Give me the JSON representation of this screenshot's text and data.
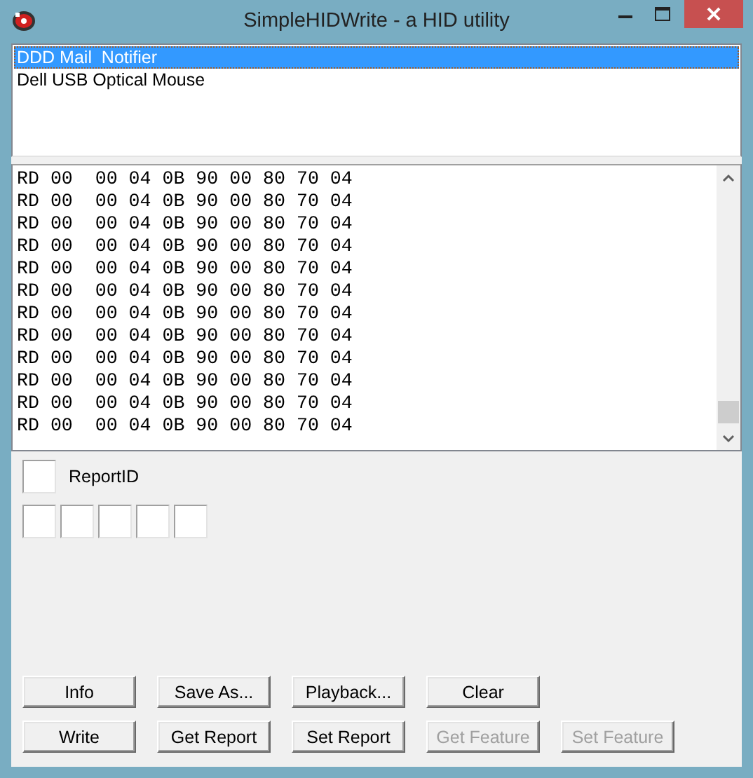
{
  "window": {
    "title": "SimpleHIDWrite - a HID utility"
  },
  "devices": [
    {
      "name": "DDD Mail  Notifier",
      "selected": true
    },
    {
      "name": "Dell USB Optical Mouse",
      "selected": false
    }
  ],
  "log": [
    "RD 00  00 04 0B 90 00 80 70 04",
    "RD 00  00 04 0B 90 00 80 70 04",
    "RD 00  00 04 0B 90 00 80 70 04",
    "RD 00  00 04 0B 90 00 80 70 04",
    "RD 00  00 04 0B 90 00 80 70 04",
    "RD 00  00 04 0B 90 00 80 70 04",
    "RD 00  00 04 0B 90 00 80 70 04",
    "RD 00  00 04 0B 90 00 80 70 04",
    "RD 00  00 04 0B 90 00 80 70 04",
    "RD 00  00 04 0B 90 00 80 70 04",
    "RD 00  00 04 0B 90 00 80 70 04",
    "RD 00  00 04 0B 90 00 80 70 04"
  ],
  "report_id": {
    "label": "ReportID"
  },
  "byte_fields": [
    {
      "kind": "hex"
    },
    {
      "kind": "hex"
    },
    {
      "kind": "hex"
    },
    {
      "kind": "hex"
    },
    {
      "kind": "hex"
    }
  ],
  "button_rows": [
    [
      {
        "label": "Info",
        "disabled": false
      },
      {
        "label": "Save As...",
        "disabled": false
      },
      {
        "label": "Playback...",
        "disabled": false
      },
      {
        "label": "Clear",
        "disabled": false
      }
    ],
    [
      {
        "label": "Write",
        "disabled": false
      },
      {
        "label": "Get Report",
        "disabled": false
      },
      {
        "label": "Set Report",
        "disabled": false
      },
      {
        "label": "Get Feature",
        "disabled": true
      },
      {
        "label": "Set Feature",
        "disabled": true
      }
    ]
  ]
}
